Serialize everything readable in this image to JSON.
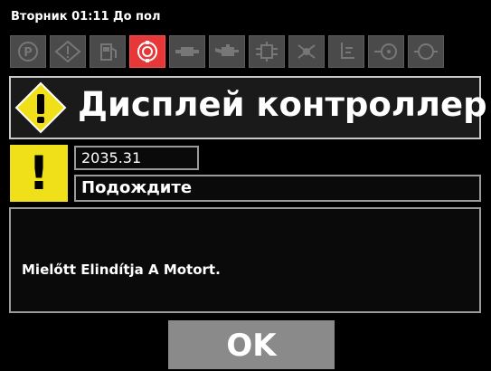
{
  "status_bar": {
    "text": "Вторник 01:11 До пол"
  },
  "icon_bar": {
    "icons": [
      {
        "name": "parking-brake-icon",
        "active": false
      },
      {
        "name": "warning-diamond-icon",
        "active": false
      },
      {
        "name": "fuel-pump-icon",
        "active": false
      },
      {
        "name": "engine-block-icon",
        "active": true
      },
      {
        "name": "battery-plug-icon",
        "active": false
      },
      {
        "name": "oil-can-icon",
        "active": false
      },
      {
        "name": "hydraulic-icon",
        "active": false
      },
      {
        "name": "fan-icon",
        "active": false
      },
      {
        "name": "coolant-level-icon",
        "active": false
      },
      {
        "name": "turbo-icon",
        "active": false
      },
      {
        "name": "filter-icon",
        "active": false
      }
    ],
    "active_color": "#e63838",
    "inactive_color": "#4a4a4a"
  },
  "title_bar": {
    "title": "Дисплей контроллер",
    "warning_color": "#f0e01a"
  },
  "alert": {
    "icon": "exclamation-icon",
    "value": "2035.31",
    "status": "Подождите"
  },
  "message": {
    "text": "Mielőtt Elindítja A Motort."
  },
  "buttons": {
    "ok_label": "OK"
  }
}
